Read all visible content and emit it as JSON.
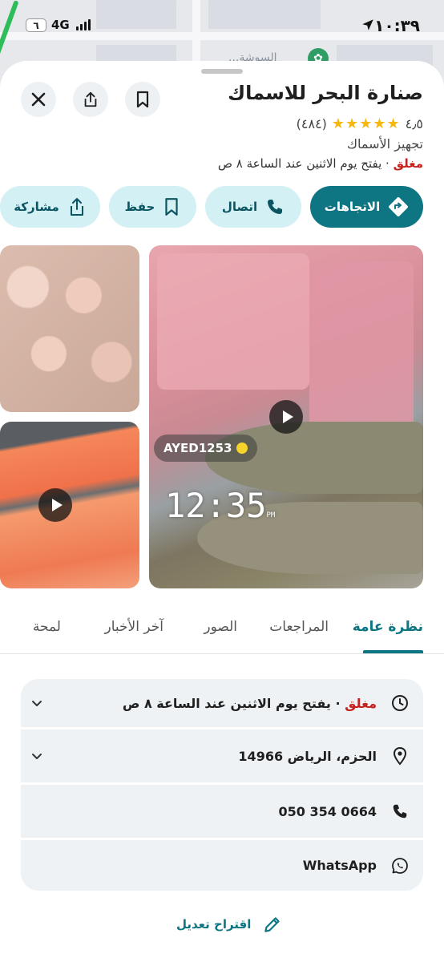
{
  "status_bar": {
    "time": "١٠:٣٩",
    "network": "4G",
    "battery": "٦"
  },
  "map": {
    "poi_label": "...السوشة"
  },
  "place": {
    "name": "صنارة البحر للاسماك",
    "rating": "٤٫٥",
    "stars": "★★★★★",
    "review_count": "(٤٨٤)",
    "category": "تجهيز الأسماك",
    "status_closed": "مغلق",
    "status_opens": " · يفتح يوم الاثنين عند الساعة ٨ ص"
  },
  "actions": {
    "directions": "الاتجاهات",
    "call": "اتصال",
    "save": "حفظ",
    "share": "مشاركة"
  },
  "photos": {
    "watermark_user": "AYED1253",
    "video_time": "12:35",
    "video_time_suffix": "PM"
  },
  "tabs": [
    {
      "label": "نظرة عامة",
      "active": true
    },
    {
      "label": "المراجعات",
      "active": false
    },
    {
      "label": "الصور",
      "active": false
    },
    {
      "label": "آخر الأخبار",
      "active": false
    },
    {
      "label": "لمحة",
      "active": false
    }
  ],
  "info": {
    "hours_closed": "مغلق",
    "hours_opens": " · يفتح يوم الاثنين عند الساعة ٨ ص",
    "address": "الحزم، الرياض 14966",
    "phone": "050 354 0664",
    "whatsapp": "WhatsApp"
  },
  "suggest_edit": "اقتراح تعديل",
  "colors": {
    "accent": "#0e7583",
    "chip_bg": "#d3f0f5",
    "closed_red": "#c5221f",
    "star": "#f6b80e"
  },
  "icons": [
    "close-icon",
    "share-icon",
    "bookmark-icon",
    "directions-icon",
    "phone-icon",
    "clock-icon",
    "location-pin-icon",
    "whatsapp-icon",
    "pencil-icon",
    "chevron-down-icon",
    "play-icon"
  ]
}
